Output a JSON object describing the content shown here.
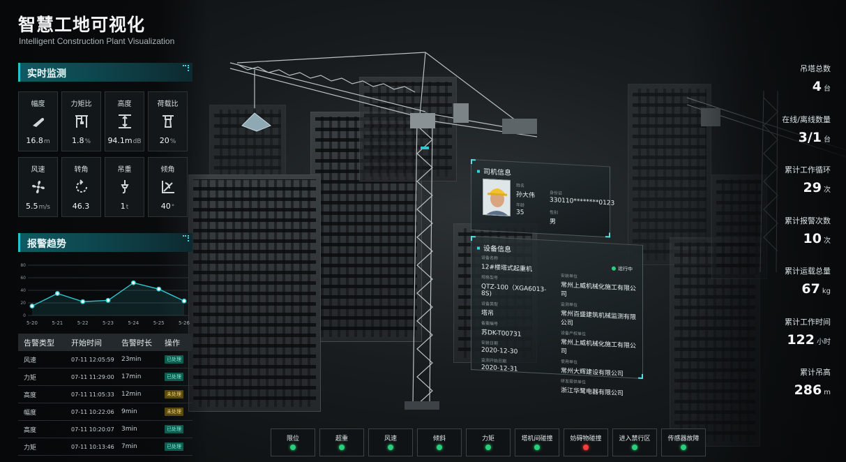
{
  "header": {
    "title": "智慧工地可视化",
    "subtitle": "Intelligent Construction Plant Visualization"
  },
  "monitor": {
    "title": "实时监测",
    "tiles": [
      {
        "label": "幅度",
        "value": "16.8",
        "unit": "m",
        "icon": "arm-icon"
      },
      {
        "label": "力矩比",
        "value": "1.8",
        "unit": "%",
        "icon": "crane-frame-icon"
      },
      {
        "label": "高度",
        "value": "94.1m",
        "unit": "dB",
        "icon": "height-icon"
      },
      {
        "label": "荷载比",
        "value": "20",
        "unit": "%",
        "icon": "load-icon"
      },
      {
        "label": "风速",
        "value": "5.5",
        "unit": "m/s",
        "icon": "fan-icon"
      },
      {
        "label": "转角",
        "value": "46.3",
        "unit": "",
        "icon": "rotate-icon"
      },
      {
        "label": "吊重",
        "value": "1",
        "unit": "t",
        "icon": "hook-icon"
      },
      {
        "label": "倾角",
        "value": "40",
        "unit": "°",
        "icon": "tilt-icon"
      }
    ]
  },
  "alarm_trend": {
    "title": "报警趋势"
  },
  "chart_data": {
    "type": "line",
    "categories": [
      "5-20",
      "5-21",
      "5-22",
      "5-23",
      "5-24",
      "5-25",
      "5-26"
    ],
    "values": [
      15,
      35,
      22,
      24,
      52,
      42,
      23
    ],
    "yticks": [
      "0",
      "20",
      "40",
      "60",
      "80"
    ],
    "ylim": [
      0,
      80
    ],
    "color": "#2ec9d0"
  },
  "alarm_table": {
    "headers": [
      "告警类型",
      "开始时间",
      "告警时长",
      "操作"
    ],
    "rows": [
      {
        "type": "风速",
        "start": "07-11 12:05:59",
        "duration": "23min",
        "status": "已处理",
        "state": "ok"
      },
      {
        "type": "力矩",
        "start": "07-11 11:29:00",
        "duration": "17min",
        "status": "已处理",
        "state": "ok"
      },
      {
        "type": "高度",
        "start": "07-11 11:05:33",
        "duration": "12min",
        "status": "未处理",
        "state": "no"
      },
      {
        "type": "幅度",
        "start": "07-11 10:22:06",
        "duration": "9min",
        "status": "未处理",
        "state": "no"
      },
      {
        "type": "高度",
        "start": "07-11 10:20:07",
        "duration": "3min",
        "status": "已处理",
        "state": "ok"
      },
      {
        "type": "力矩",
        "start": "07-11 10:13:46",
        "duration": "7min",
        "status": "已处理",
        "state": "ok"
      }
    ]
  },
  "stats": [
    {
      "label": "吊塔总数",
      "value": "4",
      "unit": "台"
    },
    {
      "label": "在线/离线数量",
      "value": "3/1",
      "unit": "台"
    },
    {
      "label": "累计工作循环",
      "value": "29",
      "unit": "次"
    },
    {
      "label": "累计报警次数",
      "value": "10",
      "unit": "次"
    },
    {
      "label": "累计运载总量",
      "value": "67",
      "unit": "kg"
    },
    {
      "label": "累计工作时间",
      "value": "122",
      "unit": "小时"
    },
    {
      "label": "累计吊高",
      "value": "286",
      "unit": "m"
    }
  ],
  "driver_card": {
    "title": "司机信息",
    "name_label": "姓名",
    "name": "孙大伟",
    "age_label": "年龄",
    "age": "35",
    "id_label": "身份证",
    "id": "330110********0123",
    "gender_label": "性别",
    "gender": "男"
  },
  "device_card": {
    "title": "设备信息",
    "status": "运行中",
    "left": [
      {
        "k": "设备名称",
        "v": "12#楼塔式起重机"
      },
      {
        "k": "规格型号",
        "v": "QTZ-100（XGA6013-8S)"
      },
      {
        "k": "设备类型",
        "v": "塔吊"
      },
      {
        "k": "备案编号",
        "v": "苏DK-T00731"
      },
      {
        "k": "安装日期",
        "v": "2020-12-30"
      },
      {
        "k": "监测开始日期",
        "v": "2020-12-31"
      }
    ],
    "right": [
      {
        "k": "安装单位",
        "v": "常州上威机械化施工有限公司"
      },
      {
        "k": "监测单位",
        "v": "常州百盛建筑机械监测有限公司"
      },
      {
        "k": "设备产权单位",
        "v": "常州上威机械化施工有限公司"
      },
      {
        "k": "使用单位",
        "v": "常州大辉建设有限公司"
      },
      {
        "k": "研发提供单位",
        "v": "浙江华鹭电器有限公司"
      }
    ]
  },
  "status_bar": [
    {
      "label": "限位",
      "state": "green"
    },
    {
      "label": "超重",
      "state": "green"
    },
    {
      "label": "风速",
      "state": "green"
    },
    {
      "label": "倾斜",
      "state": "green"
    },
    {
      "label": "力矩",
      "state": "green"
    },
    {
      "label": "塔机间碰撞",
      "state": "green"
    },
    {
      "label": "妨碍物碰撞",
      "state": "red"
    },
    {
      "label": "进入禁行区",
      "state": "green"
    },
    {
      "label": "传感器故障",
      "state": "green"
    }
  ],
  "colors": {
    "accent": "#2ec9d0",
    "ok": "#27d07a",
    "alarm": "#ff3a3a"
  }
}
